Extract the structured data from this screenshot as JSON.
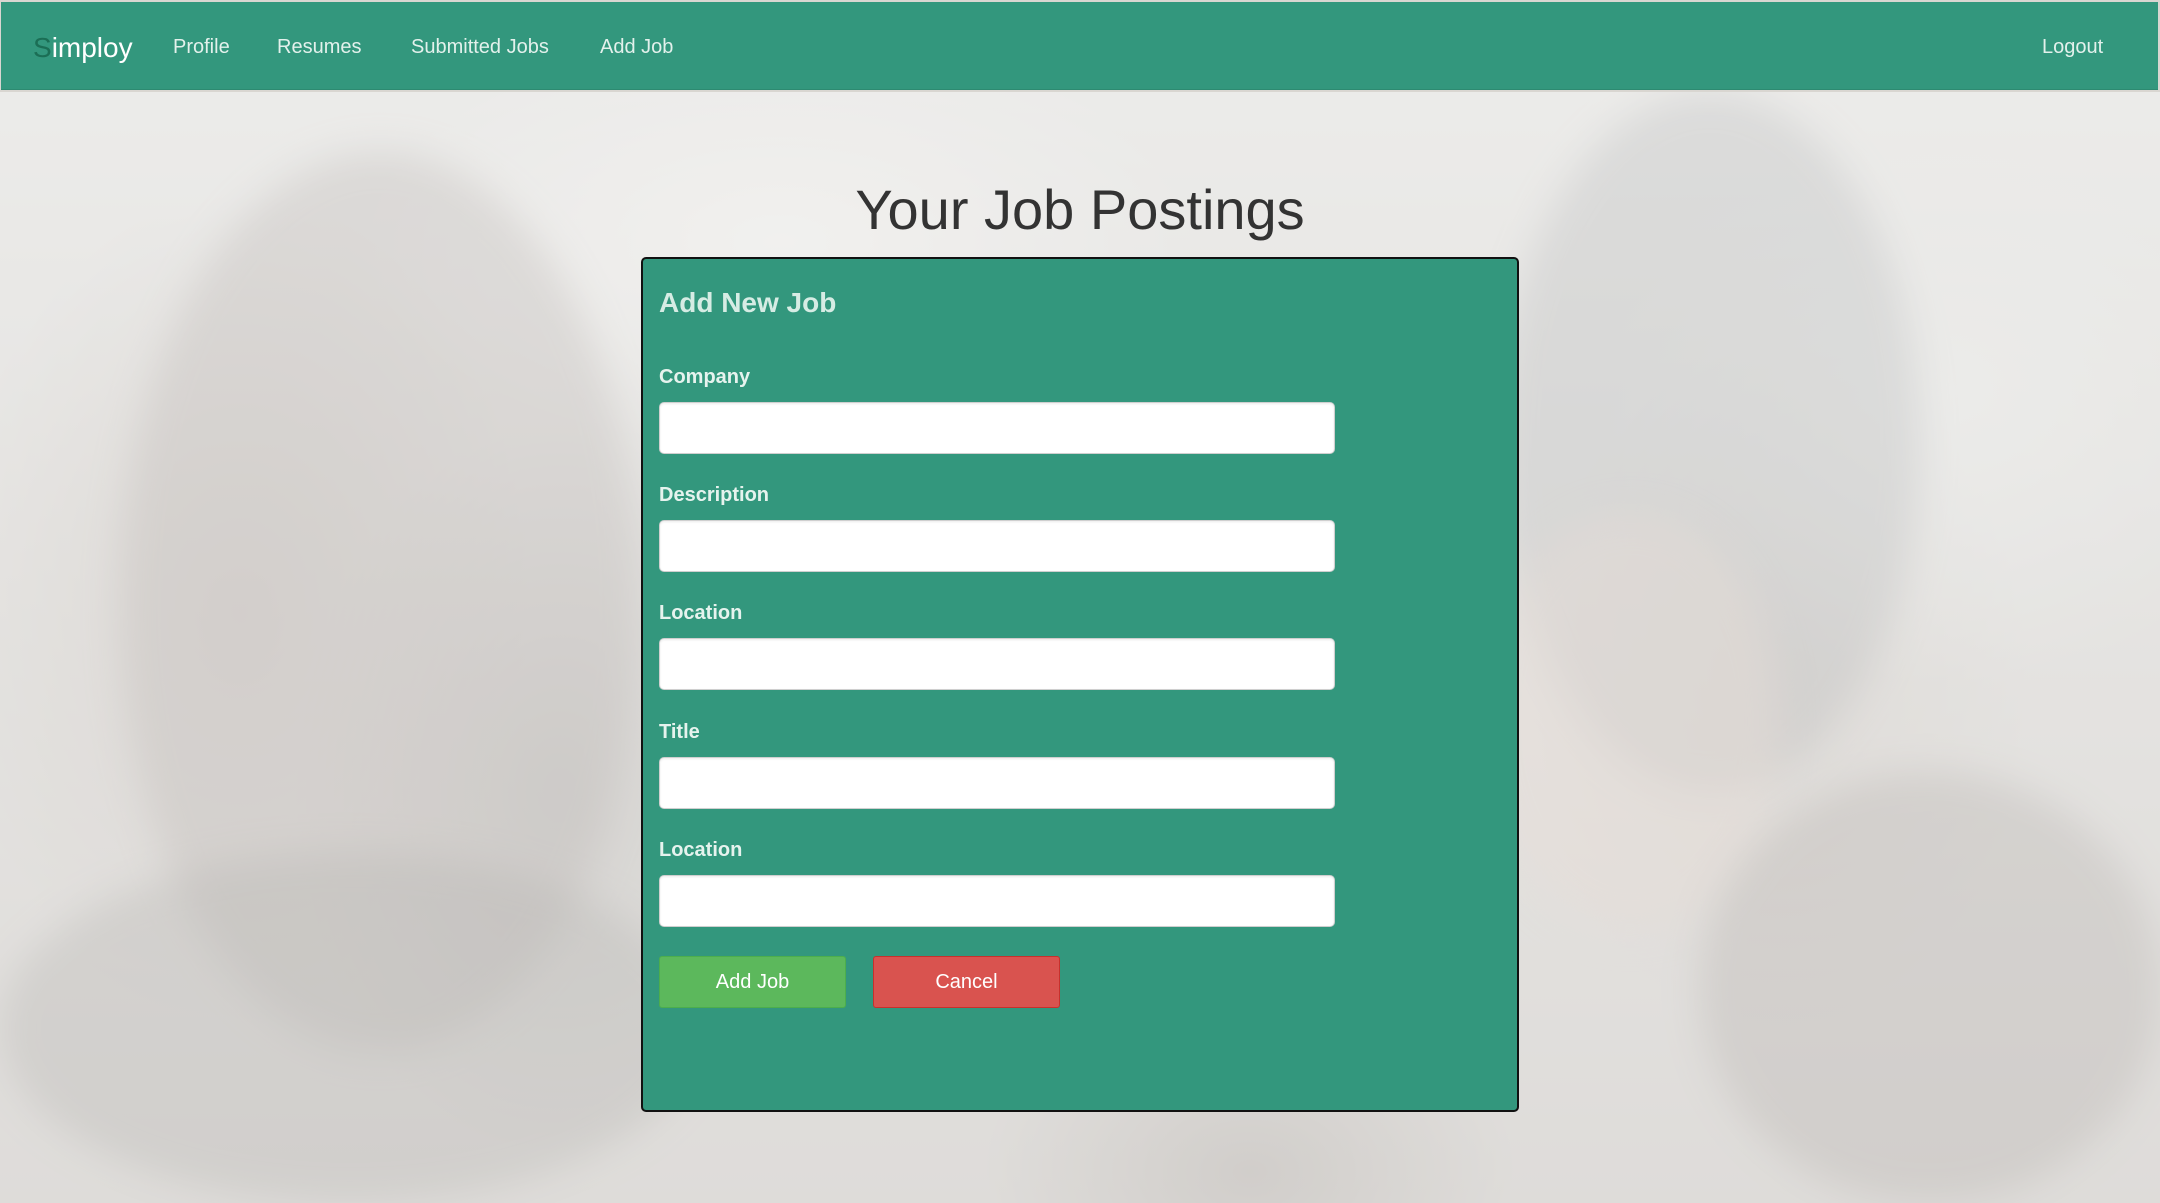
{
  "navbar": {
    "brand_first_letter": "S",
    "brand_rest": "imploy",
    "links": [
      {
        "label": "Profile"
      },
      {
        "label": "Resumes"
      },
      {
        "label": "Submitted Jobs"
      },
      {
        "label": "Add Job"
      }
    ],
    "logout_label": "Logout"
  },
  "page": {
    "title": "Your Job Postings"
  },
  "form": {
    "title": "Add New Job",
    "fields": [
      {
        "label": "Company",
        "value": "",
        "placeholder": ""
      },
      {
        "label": "Description",
        "value": "",
        "placeholder": ""
      },
      {
        "label": "Location",
        "value": "",
        "placeholder": ""
      },
      {
        "label": "Title",
        "value": "",
        "placeholder": ""
      },
      {
        "label": "Location",
        "value": "",
        "placeholder": ""
      }
    ],
    "submit_label": "Add Job",
    "cancel_label": "Cancel"
  },
  "colors": {
    "primary": "#33977d",
    "brand_accent": "#1b6e55",
    "success": "#5cb85c",
    "danger": "#d9534f"
  }
}
